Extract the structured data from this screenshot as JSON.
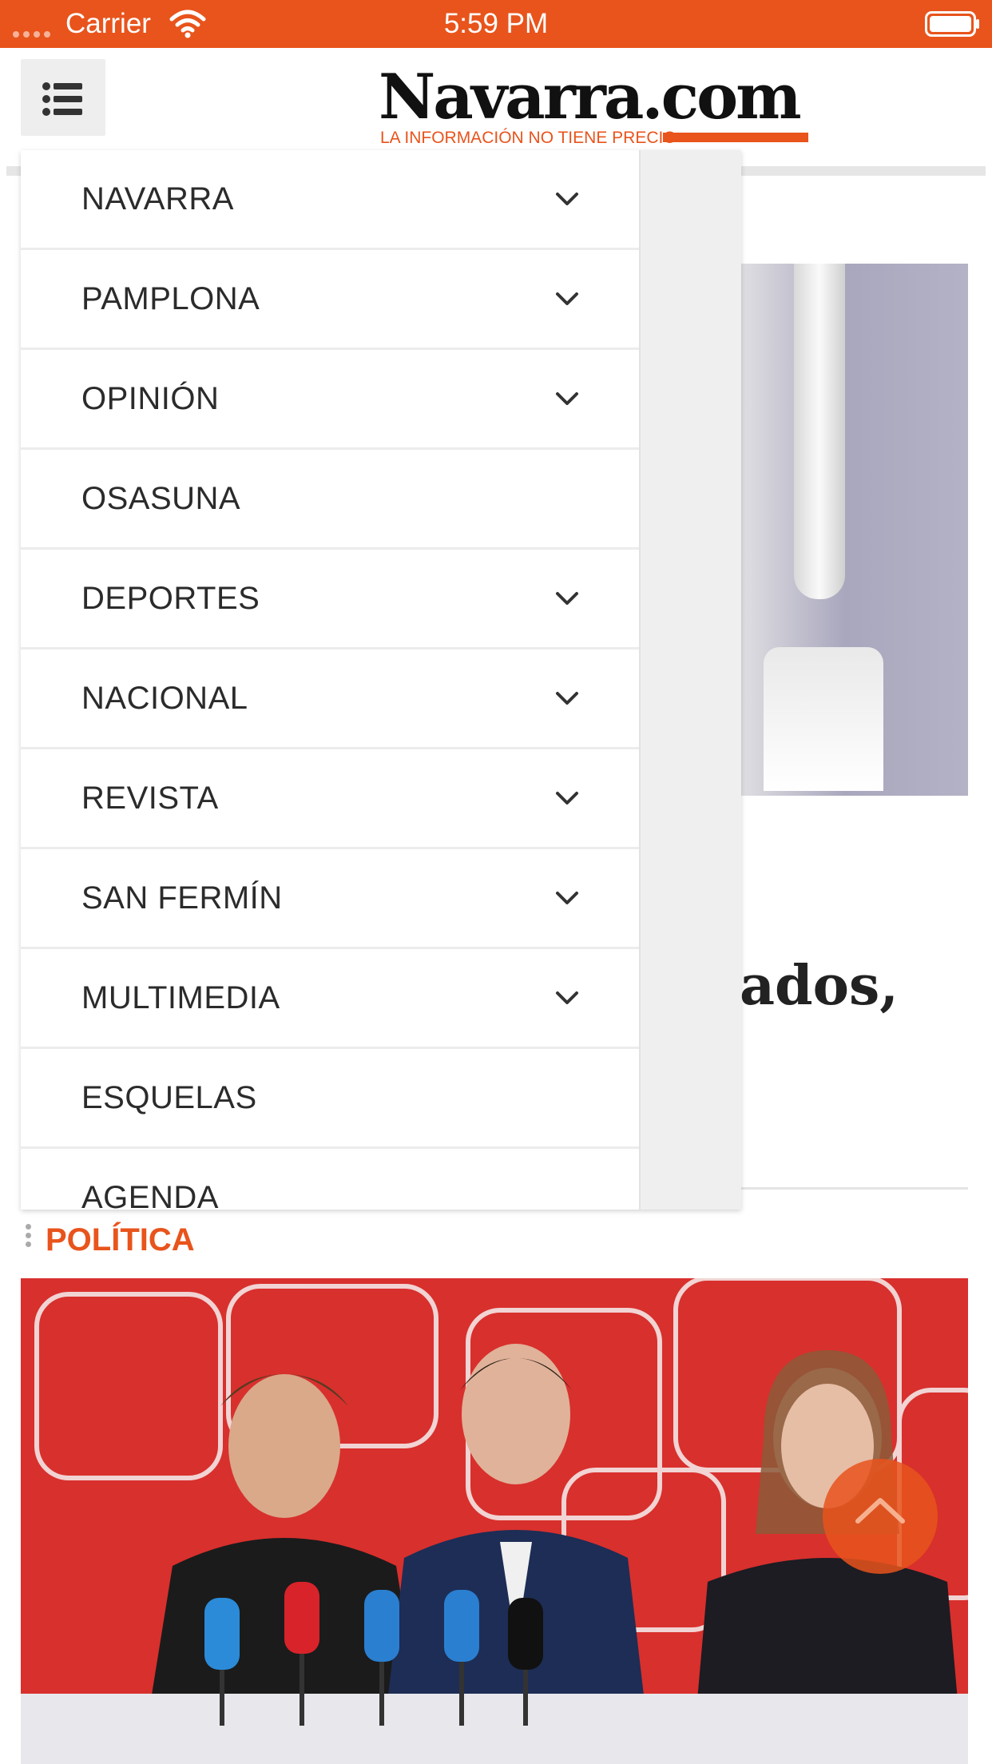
{
  "status_bar": {
    "carrier": "Carrier",
    "time": "5:59 PM"
  },
  "header": {
    "logo_title": "Navarra.com",
    "logo_tagline": "LA INFORMACIÓN NO TIENE PRECIO",
    "menu_icon": "list-icon"
  },
  "menu": {
    "items": [
      {
        "label": "NAVARRA",
        "expandable": true
      },
      {
        "label": "PAMPLONA",
        "expandable": true
      },
      {
        "label": "OPINIÓN",
        "expandable": true
      },
      {
        "label": "OSASUNA",
        "expandable": false
      },
      {
        "label": "DEPORTES",
        "expandable": true
      },
      {
        "label": "NACIONAL",
        "expandable": true
      },
      {
        "label": "REVISTA",
        "expandable": true
      },
      {
        "label": "SAN FERMÍN",
        "expandable": true
      },
      {
        "label": "MULTIMEDIA",
        "expandable": true
      },
      {
        "label": "ESQUELAS",
        "expandable": false
      },
      {
        "label": "AGENDA",
        "expandable": false
      }
    ]
  },
  "article": {
    "headline_fragment": "ados,"
  },
  "section": {
    "label": "POLÍTICA"
  },
  "colors": {
    "brand": "#e8541c",
    "menu_text": "#2b2b2b"
  }
}
